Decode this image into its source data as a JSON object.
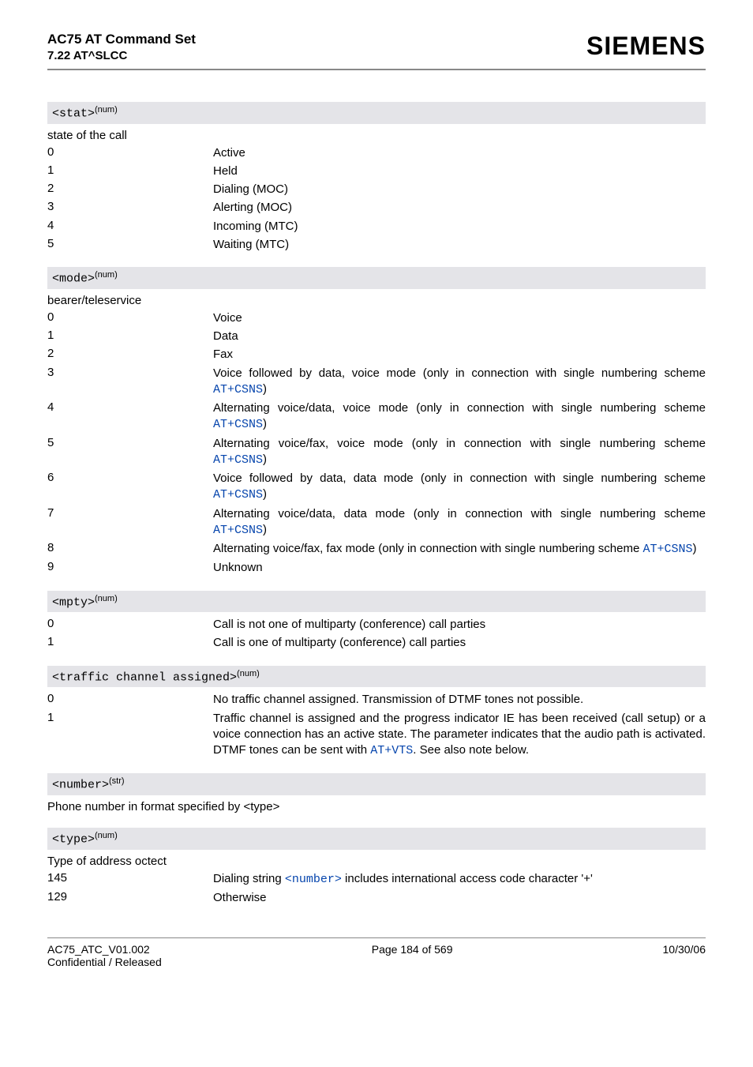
{
  "header": {
    "title": "AC75 AT Command Set",
    "subtitle": "7.22 AT^SLCC",
    "brand": "SIEMENS"
  },
  "sections": [
    {
      "band": {
        "code": "<stat>",
        "sup": "(num)"
      },
      "intro": "state of the call",
      "rows": [
        {
          "key": "0",
          "val": [
            {
              "t": "Active"
            }
          ]
        },
        {
          "key": "1",
          "val": [
            {
              "t": "Held"
            }
          ]
        },
        {
          "key": "2",
          "val": [
            {
              "t": "Dialing (MOC)"
            }
          ]
        },
        {
          "key": "3",
          "val": [
            {
              "t": "Alerting (MOC)"
            }
          ]
        },
        {
          "key": "4",
          "val": [
            {
              "t": "Incoming (MTC)"
            }
          ]
        },
        {
          "key": "5",
          "val": [
            {
              "t": "Waiting (MTC)"
            }
          ]
        }
      ]
    },
    {
      "band": {
        "code": "<mode>",
        "sup": "(num)"
      },
      "intro": "bearer/teleservice",
      "rows": [
        {
          "key": "0",
          "val": [
            {
              "t": "Voice"
            }
          ]
        },
        {
          "key": "1",
          "val": [
            {
              "t": "Data"
            }
          ]
        },
        {
          "key": "2",
          "val": [
            {
              "t": "Fax"
            }
          ]
        },
        {
          "key": "3",
          "val": [
            {
              "t": "Voice followed by data, voice mode (only in connection with single numbering scheme "
            },
            {
              "code": "AT+CSNS"
            },
            {
              "t": ")"
            }
          ]
        },
        {
          "key": "4",
          "val": [
            {
              "t": "Alternating voice/data, voice mode (only in connection with single numbering scheme "
            },
            {
              "code": "AT+CSNS"
            },
            {
              "t": ")"
            }
          ]
        },
        {
          "key": "5",
          "val": [
            {
              "t": "Alternating voice/fax, voice mode (only in connection with single numbering scheme "
            },
            {
              "code": "AT+CSNS"
            },
            {
              "t": ")"
            }
          ]
        },
        {
          "key": "6",
          "val": [
            {
              "t": "Voice followed by data, data mode (only in connection with single numbering scheme "
            },
            {
              "code": "AT+CSNS"
            },
            {
              "t": ")"
            }
          ]
        },
        {
          "key": "7",
          "val": [
            {
              "t": "Alternating voice/data, data mode (only in connection with single numbering scheme "
            },
            {
              "code": "AT+CSNS"
            },
            {
              "t": ")"
            }
          ]
        },
        {
          "key": "8",
          "val": [
            {
              "t": "Alternating voice/fax, fax mode (only in connection with single numbering scheme "
            },
            {
              "code": "AT+CSNS"
            },
            {
              "t": ")"
            }
          ]
        },
        {
          "key": "9",
          "val": [
            {
              "t": "Unknown"
            }
          ]
        }
      ]
    },
    {
      "band": {
        "code": "<mpty>",
        "sup": "(num)"
      },
      "intro": "",
      "rows": [
        {
          "key": "0",
          "val": [
            {
              "t": "Call is not one of multiparty (conference) call parties"
            }
          ]
        },
        {
          "key": "1",
          "val": [
            {
              "t": "Call is one of multiparty (conference) call parties"
            }
          ]
        }
      ]
    },
    {
      "band": {
        "code": "<traffic channel assigned>",
        "sup": "(num)"
      },
      "intro": "",
      "rows": [
        {
          "key": "0",
          "val": [
            {
              "t": "No traffic channel assigned. Transmission of DTMF tones not possible."
            }
          ]
        },
        {
          "key": "1",
          "val": [
            {
              "t": "Traffic channel is assigned and the progress indicator IE has been received (call setup) or a voice connection has an active state. The parameter indicates that the audio path is activated. DTMF tones can be sent with "
            },
            {
              "code": "AT+VTS"
            },
            {
              "t": ". See also note below."
            }
          ]
        }
      ]
    },
    {
      "band": {
        "code": "<number>",
        "sup": "(str)"
      },
      "intro_rich": [
        {
          "t": "Phone number in format specified by "
        },
        {
          "code": "<type>"
        }
      ],
      "rows": []
    },
    {
      "band": {
        "code": "<type>",
        "sup": "(num)"
      },
      "intro": "Type of address octect",
      "rows": [
        {
          "key": "145",
          "val": [
            {
              "t": "Dialing string "
            },
            {
              "code": "<number>"
            },
            {
              "t": " includes international access code character '+'"
            }
          ]
        },
        {
          "key": "129",
          "val": [
            {
              "t": "Otherwise"
            }
          ]
        }
      ]
    }
  ],
  "footer": {
    "left1": "AC75_ATC_V01.002",
    "left2": "Confidential / Released",
    "center": "Page 184 of 569",
    "right": "10/30/06"
  }
}
